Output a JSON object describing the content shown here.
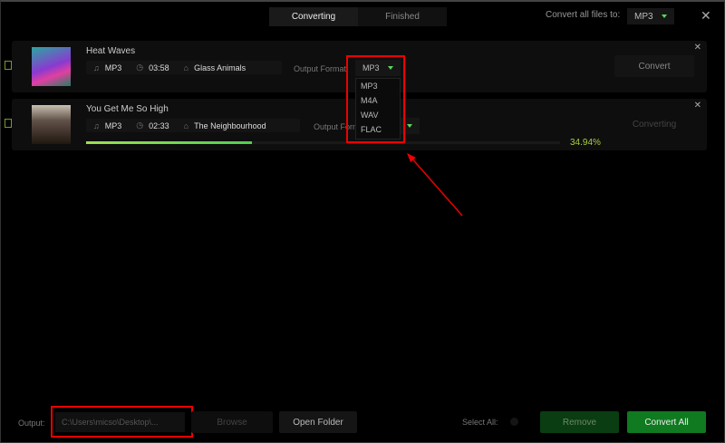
{
  "tabs": [
    {
      "label": "Converting",
      "active": true
    },
    {
      "label": "Finished",
      "active": false
    }
  ],
  "convert_all": {
    "label": "Convert all files to:",
    "value": "MP3"
  },
  "tracks": [
    {
      "title": "Heat Waves",
      "format": "MP3",
      "duration": "03:58",
      "artist": "Glass Animals",
      "output_format_label": "Output Format",
      "output_format": "MP3",
      "action": "Convert"
    },
    {
      "title": "You Get Me So High",
      "format": "MP3",
      "duration": "02:33",
      "artist": "The Neighbourhood",
      "output_format_label": "Output Format",
      "output_format": "MP3",
      "action": "Converting",
      "progress_percent": 34.94,
      "progress_text": "34.94%"
    }
  ],
  "dropdown_options": [
    "MP3",
    "M4A",
    "WAV",
    "FLAC"
  ],
  "footer": {
    "output_label": "Output:",
    "output_path": "C:\\Users\\micso\\Desktop\\...",
    "browse": "Browse",
    "open_folder": "Open Folder",
    "select_all": "Select All:",
    "remove": "Remove",
    "convert_all": "Convert All"
  },
  "colors": {
    "accent": "#5cd65c",
    "convert_all_bg": "#0f7a1f",
    "remove_bg": "#0a3d12",
    "highlight": "#e00000"
  }
}
